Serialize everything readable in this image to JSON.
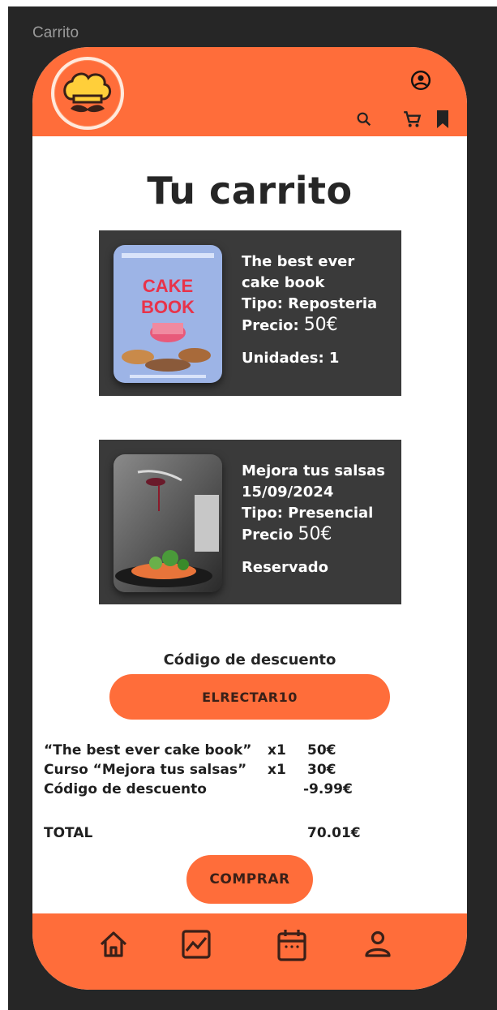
{
  "window": {
    "title": "Carrito"
  },
  "header": {
    "logo_icon": "chef-hat-mustache-icon",
    "account_icon": "account-circle-icon",
    "search_icon": "search-icon",
    "cart_icon": "cart-icon",
    "bookmark_icon": "bookmark-icon"
  },
  "page": {
    "title": "Tu carrito"
  },
  "cart": {
    "items": [
      {
        "name_line1": "The best ever",
        "name_line2": "cake book",
        "type": "Tipo: Reposteria",
        "price_label": "Precio:",
        "price": "50€",
        "extra": "Unidades: 1",
        "image": "cake-book-cover"
      },
      {
        "name_line1": "Mejora tus salsas",
        "name_line2": "15/09/2024",
        "type": "Tipo: Presencial",
        "price_label": "Precio",
        "price": "50€",
        "extra": "Reservado",
        "image": "sauce-plate-photo"
      }
    ]
  },
  "discount": {
    "label": "Código de descuento",
    "code": "ELRECTAR10"
  },
  "summary": {
    "rows": [
      {
        "name": "“The best ever cake book”",
        "qty": "x1",
        "amount": "50€"
      },
      {
        "name": "Curso “Mejora tus salsas”",
        "qty": "x1",
        "amount": "30€"
      },
      {
        "name": "Código de descuento",
        "qty": "",
        "amount": "-9.99€"
      }
    ],
    "total_label": "TOTAL",
    "total_amount": "70.01€"
  },
  "actions": {
    "buy_label": "COMPRAR"
  },
  "bottom_nav": {
    "items": [
      "home-icon",
      "chart-icon",
      "calendar-icon",
      "person-icon"
    ]
  },
  "colors": {
    "accent": "#ff6d3a",
    "card": "#3a3a3a",
    "frame": "#262626"
  }
}
